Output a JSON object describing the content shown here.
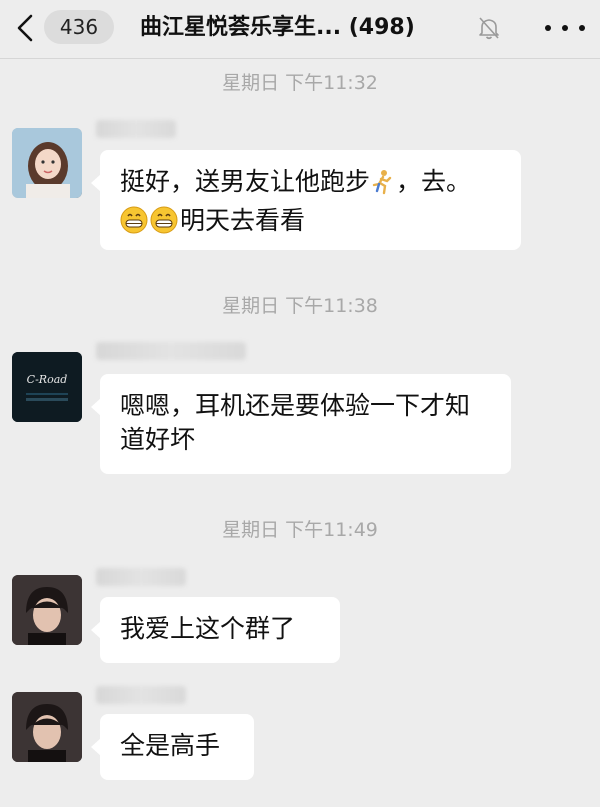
{
  "header": {
    "unread_count": "436",
    "title": "曲江星悦荟乐享生... (498)"
  },
  "messages": [
    {
      "timestamp": "星期日 下午11:32",
      "text_line1_a": "挺好，送男友让他跑步",
      "text_line1_b": "，去。",
      "text_line2": "明天去看看"
    },
    {
      "timestamp": "星期日 下午11:38",
      "text": "嗯嗯，耳机还是要体验一下才知道好坏"
    },
    {
      "timestamp": "星期日 下午11:49",
      "text": "我爱上这个群了"
    },
    {
      "text": "全是高手"
    }
  ],
  "avatar_logo_text": "C-Road",
  "colors": {
    "background": "#ededed",
    "bubble": "#ffffff",
    "timestamp": "#a8a8a8"
  }
}
